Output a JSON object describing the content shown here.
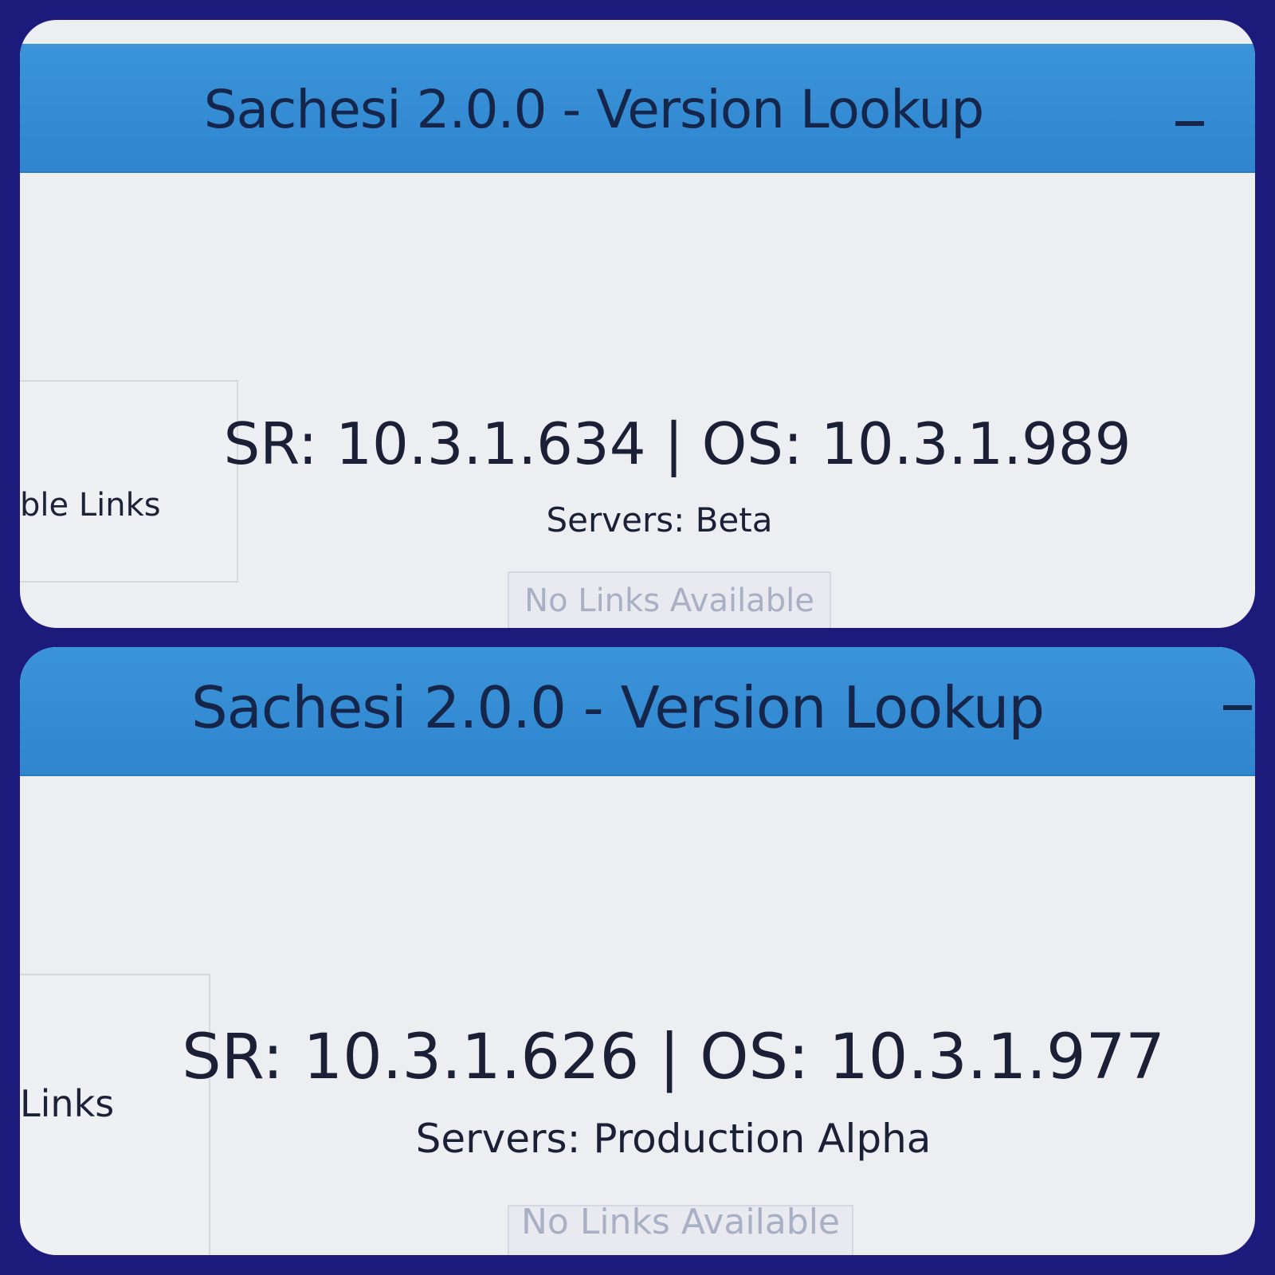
{
  "colors": {
    "frame_border": "#1c1a7a",
    "titlebar": "#3b93d9",
    "panel_background": "#eceef2",
    "text": "#1b2036",
    "disabled_text": "#a9afc4"
  },
  "panels": [
    {
      "window_title": "Sachesi 2.0.0 - Version Lookup",
      "minimize_icon": "minimize-icon",
      "links_label_partial": "ble Links",
      "version_line": "SR: 10.3.1.634 | OS: 10.3.1.989",
      "servers_line": "Servers: Beta",
      "links_button": "No Links Available"
    },
    {
      "window_title": "Sachesi 2.0.0 - Version Lookup",
      "minimize_icon": "minimize-icon",
      "links_label_partial": "Links",
      "version_line": "SR: 10.3.1.626 | OS: 10.3.1.977",
      "servers_line": "Servers: Production Alpha",
      "links_button": "No Links Available"
    }
  ]
}
